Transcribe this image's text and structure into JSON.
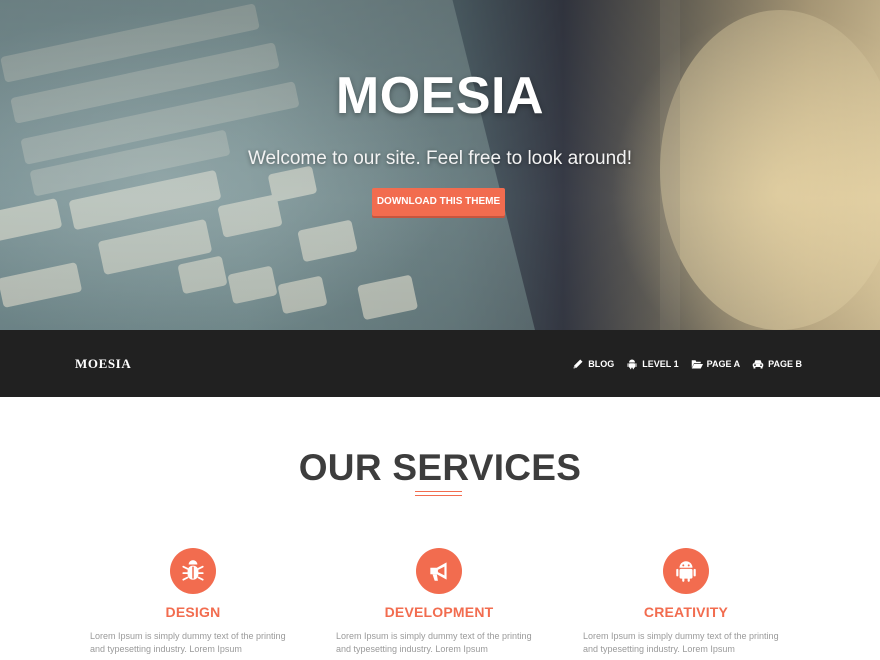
{
  "hero": {
    "title": "MOESIA",
    "subtitle": "Welcome to our site. Feel free to look around!",
    "button_label": "DOWNLOAD THIS THEME"
  },
  "navbar": {
    "brand": "MOESIA",
    "items": [
      {
        "label": "BLOG",
        "icon": "pencil-icon"
      },
      {
        "label": "LEVEL 1",
        "icon": "android-icon"
      },
      {
        "label": "PAGE A",
        "icon": "folder-open-icon"
      },
      {
        "label": "PAGE B",
        "icon": "car-icon"
      }
    ]
  },
  "services": {
    "title": "OUR SERVICES",
    "items": [
      {
        "title": "DESIGN",
        "icon": "bug-icon",
        "text": "Lorem Ipsum is simply dummy text of the printing and typesetting industry. Lorem Ipsum"
      },
      {
        "title": "DEVELOPMENT",
        "icon": "megaphone-icon",
        "text": "Lorem Ipsum is simply dummy text of the printing and typesetting industry. Lorem Ipsum"
      },
      {
        "title": "CREATIVITY",
        "icon": "android-icon",
        "text": "Lorem Ipsum is simply dummy text of the printing and typesetting industry. Lorem Ipsum"
      }
    ]
  },
  "colors": {
    "accent": "#f26c4f",
    "navbar": "#212121",
    "heading": "#3d3d3d",
    "body_text": "#9a9a9a"
  }
}
